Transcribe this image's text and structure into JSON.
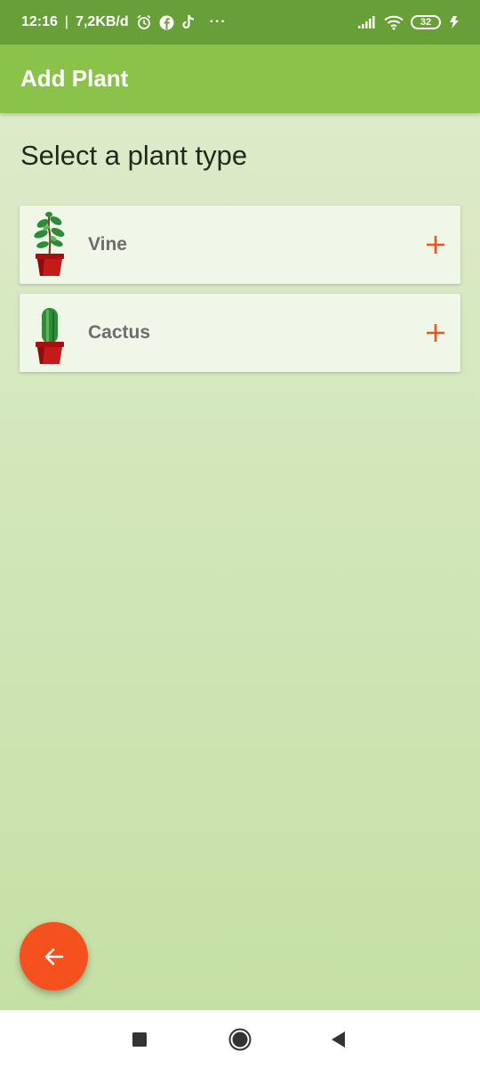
{
  "status_bar": {
    "time": "12:16",
    "separator": "|",
    "network_speed": "7,2KB/d",
    "more": "···",
    "battery_level": "32",
    "icons": [
      "alarm-icon",
      "facebook-icon",
      "tiktok-icon",
      "signal-icon",
      "wifi-icon",
      "battery-icon",
      "charging-icon"
    ]
  },
  "app_bar": {
    "title": "Add Plant"
  },
  "main": {
    "heading": "Select a plant type",
    "plants": [
      {
        "name": "Vine",
        "icon": "vine-plant-icon"
      },
      {
        "name": "Cactus",
        "icon": "cactus-plant-icon"
      }
    ]
  },
  "fab": {
    "icon": "arrow-back-icon"
  },
  "nav_bar": {
    "icons": [
      "recents-icon",
      "home-icon",
      "back-icon"
    ]
  },
  "colors": {
    "status_bar": "#689f38",
    "app_bar": "#8bc34a",
    "accent": "#f4511e",
    "card": "#f0f6e8",
    "plant_name": "#6d6d6d"
  }
}
